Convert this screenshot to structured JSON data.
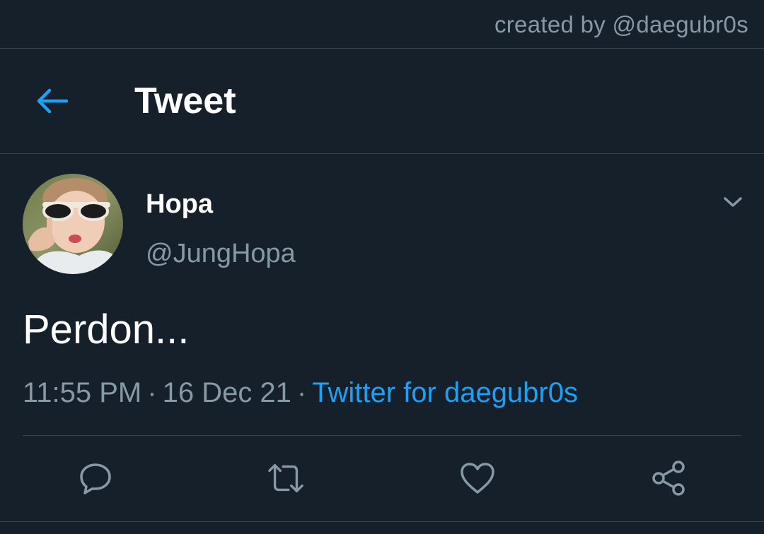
{
  "credit": "created by @daegubr0s",
  "header": {
    "title": "Tweet",
    "back_icon": "arrow-left-icon"
  },
  "tweet": {
    "display_name": "Hopa",
    "handle": "@JungHopa",
    "text": "Perdon...",
    "time": "11:55 PM",
    "separator": "·",
    "date": "16 Dec 21",
    "source": "Twitter for daegubr0s"
  },
  "actions": [
    {
      "name": "reply",
      "icon": "speech-bubble-icon"
    },
    {
      "name": "retweet",
      "icon": "retweet-arrows-icon"
    },
    {
      "name": "like",
      "icon": "heart-icon"
    },
    {
      "name": "share",
      "icon": "share-nodes-icon"
    }
  ],
  "colors": {
    "background": "#15202b",
    "accent": "#1da1f2",
    "secondary_text": "#8899a6",
    "divider": "#38444d"
  }
}
